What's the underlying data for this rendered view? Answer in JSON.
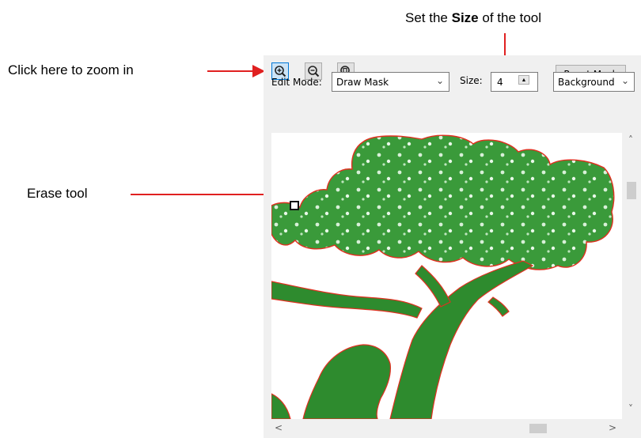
{
  "callouts": {
    "zoom_text": "Click here to zoom in",
    "size_text_prefix": "Set the ",
    "size_text_bold": "Size",
    "size_text_suffix": " of the tool",
    "erase_text": "Erase tool",
    "arrow_color": "#e02020"
  },
  "toolbar": {
    "zoom_in_icon": "zoom-in-icon",
    "zoom_out_icon": "zoom-out-icon",
    "zoom_fit_icon": "zoom-fit-icon",
    "reset_label": "Reset Mask"
  },
  "options": {
    "edit_mode_label": "Edit Mode:",
    "edit_mode_value": "Draw Mask",
    "size_label": "Size:",
    "size_value": "4",
    "mask_value": "Background"
  },
  "canvas": {
    "mask_color": "#2e8b2e",
    "outline_color": "#e03020",
    "cursor_icon": "erase-cursor-icon"
  },
  "scrollbars": {
    "up_arrow": "˄",
    "down_arrow": "˅",
    "left_arrow": "<",
    "right_arrow": ">"
  }
}
